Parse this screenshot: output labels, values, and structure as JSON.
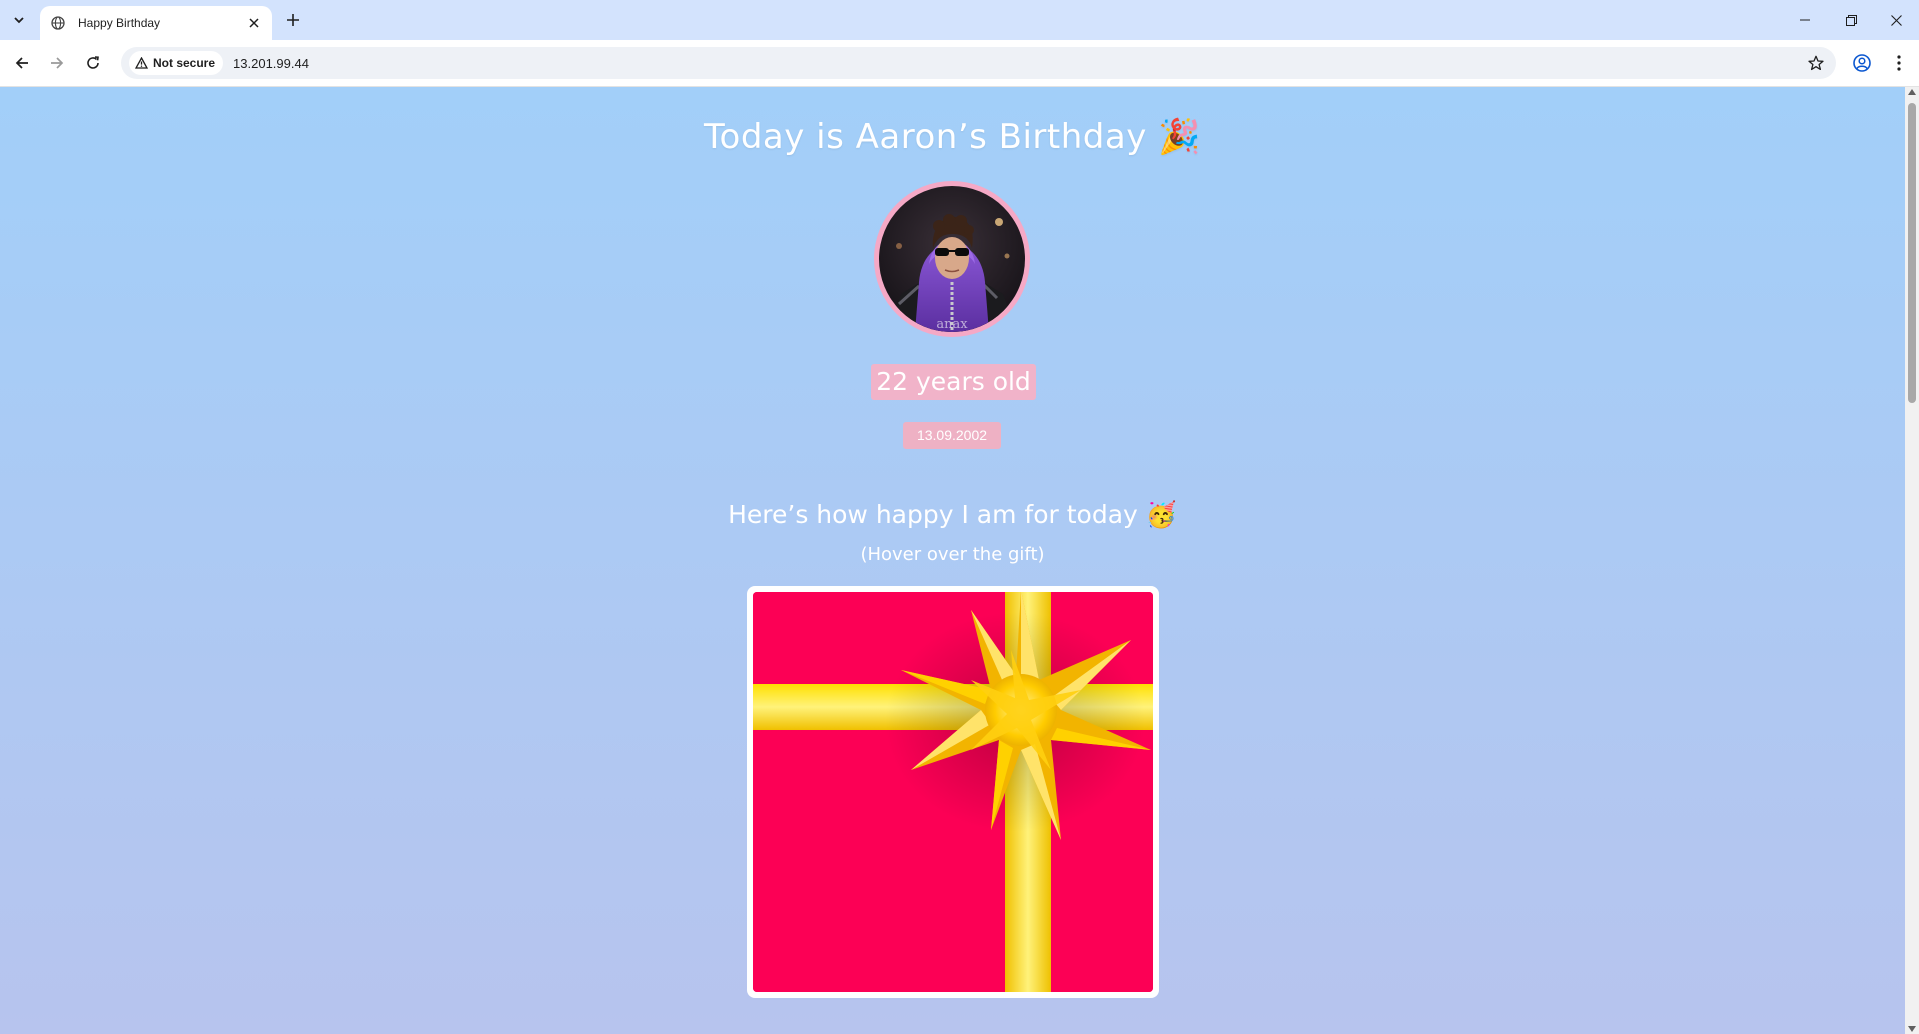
{
  "browser": {
    "tab_title": "Happy Birthday",
    "security_label": "Not secure",
    "url": "13.201.99.44"
  },
  "page": {
    "headline": "Today is Aaron’s Birthday",
    "headline_emoji": "🎉",
    "age_text": "22 years old",
    "birth_date": "13.09.2002",
    "subhead": "Here’s how happy I am for today",
    "subhead_emoji": "🥳",
    "hint": "(Hover over the gift)"
  },
  "colors": {
    "background_top": "#a2cff9",
    "background_bottom": "#b7c4ee",
    "accent_pink": "#f1b3c9",
    "gift_red": "#fc0055",
    "ribbon_gold": "#ffd400"
  },
  "icons": [
    "tab-search-icon",
    "globe-icon",
    "close-icon",
    "plus-icon",
    "minimize-icon",
    "restore-icon",
    "back-arrow-icon",
    "forward-arrow-icon",
    "reload-icon",
    "warning-icon",
    "star-icon",
    "profile-icon",
    "kebab-menu-icon"
  ]
}
